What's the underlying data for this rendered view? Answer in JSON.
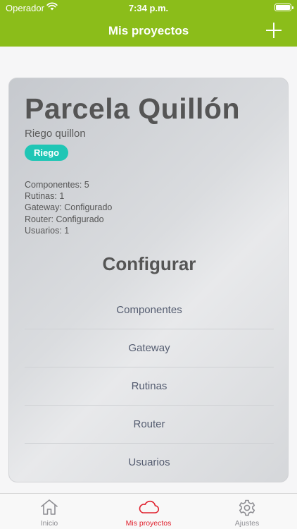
{
  "status_bar": {
    "carrier": "Operador",
    "time": "7:34 p.m."
  },
  "nav": {
    "title": "Mis proyectos",
    "add_icon": "plus-icon"
  },
  "project": {
    "title": "Parcela Quillón",
    "subtitle": "Riego quillon",
    "tag": "Riego",
    "stats": [
      "Componentes: 5",
      "Rutinas: 1",
      "Gateway: Configurado",
      "Router: Configurado",
      "Usuarios: 1"
    ]
  },
  "configure": {
    "heading": "Configurar",
    "items": [
      "Componentes",
      "Gateway",
      "Rutinas",
      "Router",
      "Usuarios"
    ]
  },
  "tabs": [
    {
      "label": "Inicio",
      "icon": "home-icon",
      "active": false
    },
    {
      "label": "Mis proyectos",
      "icon": "cloud-icon",
      "active": true
    },
    {
      "label": "Ajustes",
      "icon": "gear-icon",
      "active": false
    }
  ],
  "colors": {
    "accent_green": "#8bbd1a",
    "tag_teal": "#1fc6b5",
    "active_tab_red": "#e0202d"
  }
}
